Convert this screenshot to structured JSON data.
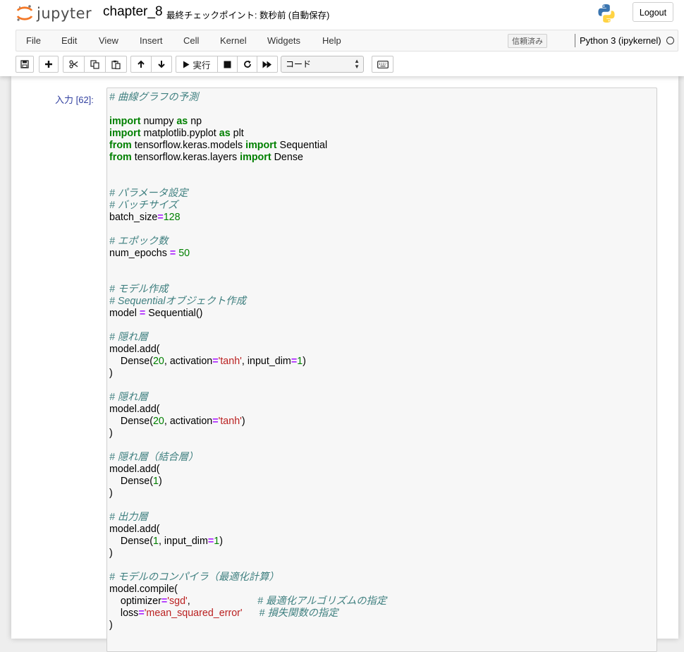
{
  "header": {
    "logo_text": "jupyter",
    "notebook_title": "chapter_8",
    "checkpoint_status": "最終チェックポイント: 数秒前 (自動保存)",
    "logout_label": "Logout"
  },
  "menu": {
    "items": [
      "File",
      "Edit",
      "View",
      "Insert",
      "Cell",
      "Kernel",
      "Widgets",
      "Help"
    ],
    "trusted_label": "信頼済み",
    "kernel_name": "Python 3 (ipykernel)"
  },
  "toolbar": {
    "run_label": "実行",
    "cell_type_selected": "コード"
  },
  "cell": {
    "prompt": "入力 [62]:",
    "code_lines": [
      [
        [
          "cm",
          "# 曲線グラフの予測"
        ]
      ],
      [],
      [
        [
          "kw",
          "import"
        ],
        [
          "",
          " numpy "
        ],
        [
          "kw",
          "as"
        ],
        [
          "",
          " np"
        ]
      ],
      [
        [
          "kw",
          "import"
        ],
        [
          "",
          " matplotlib.pyplot "
        ],
        [
          "kw",
          "as"
        ],
        [
          "",
          " plt"
        ]
      ],
      [
        [
          "kw",
          "from"
        ],
        [
          "",
          " tensorflow.keras.models "
        ],
        [
          "kw",
          "import"
        ],
        [
          "",
          " Sequential"
        ]
      ],
      [
        [
          "kw",
          "from"
        ],
        [
          "",
          " tensorflow.keras.layers "
        ],
        [
          "kw",
          "import"
        ],
        [
          "",
          " Dense"
        ]
      ],
      [],
      [],
      [
        [
          "cm",
          "# パラメータ設定"
        ]
      ],
      [
        [
          "cm",
          "# バッチサイズ"
        ]
      ],
      [
        [
          "",
          "batch_size"
        ],
        [
          "op",
          "="
        ],
        [
          "num",
          "128"
        ]
      ],
      [],
      [
        [
          "cm",
          "# エポック数"
        ]
      ],
      [
        [
          "",
          "num_epochs "
        ],
        [
          "op",
          "="
        ],
        [
          "",
          " "
        ],
        [
          "num",
          "50"
        ]
      ],
      [],
      [],
      [
        [
          "cm",
          "# モデル作成"
        ]
      ],
      [
        [
          "cm",
          "# Sequentialオブジェクト作成"
        ]
      ],
      [
        [
          "",
          "model "
        ],
        [
          "op",
          "="
        ],
        [
          "",
          " Sequential()"
        ]
      ],
      [],
      [
        [
          "cm",
          "# 隠れ層"
        ]
      ],
      [
        [
          "",
          "model.add("
        ]
      ],
      [
        [
          "",
          "    Dense("
        ],
        [
          "num",
          "20"
        ],
        [
          "",
          ", activation"
        ],
        [
          "op",
          "="
        ],
        [
          "str",
          "'tanh'"
        ],
        [
          "",
          ", input_dim"
        ],
        [
          "op",
          "="
        ],
        [
          "num",
          "1"
        ],
        [
          "",
          ")"
        ]
      ],
      [
        [
          "",
          ")"
        ]
      ],
      [],
      [
        [
          "cm",
          "# 隠れ層"
        ]
      ],
      [
        [
          "",
          "model.add("
        ]
      ],
      [
        [
          "",
          "    Dense("
        ],
        [
          "num",
          "20"
        ],
        [
          "",
          ", activation"
        ],
        [
          "op",
          "="
        ],
        [
          "str",
          "'tanh'"
        ],
        [
          "",
          ")"
        ]
      ],
      [
        [
          "",
          ")"
        ]
      ],
      [],
      [
        [
          "cm",
          "# 隠れ層（結合層）"
        ]
      ],
      [
        [
          "",
          "model.add("
        ]
      ],
      [
        [
          "",
          "    Dense("
        ],
        [
          "num",
          "1"
        ],
        [
          "",
          ")"
        ]
      ],
      [
        [
          "",
          ")"
        ]
      ],
      [],
      [
        [
          "cm",
          "# 出力層"
        ]
      ],
      [
        [
          "",
          "model.add("
        ]
      ],
      [
        [
          "",
          "    Dense("
        ],
        [
          "num",
          "1"
        ],
        [
          "",
          ", input_dim"
        ],
        [
          "op",
          "="
        ],
        [
          "num",
          "1"
        ],
        [
          "",
          ")"
        ]
      ],
      [
        [
          "",
          ")"
        ]
      ],
      [],
      [
        [
          "cm",
          "# モデルのコンパイラ（最適化計算）"
        ]
      ],
      [
        [
          "",
          "model.compile("
        ]
      ],
      [
        [
          "",
          "    optimizer"
        ],
        [
          "op",
          "="
        ],
        [
          "str",
          "'sgd'"
        ],
        [
          "",
          ",                        "
        ],
        [
          "cm",
          "# 最適化アルゴリズムの指定"
        ]
      ],
      [
        [
          "",
          "    loss"
        ],
        [
          "op",
          "="
        ],
        [
          "str",
          "'mean_squared_error'"
        ],
        [
          "",
          "      "
        ],
        [
          "cm",
          "# 損失関数の指定"
        ]
      ],
      [
        [
          "",
          ")"
        ]
      ]
    ]
  }
}
